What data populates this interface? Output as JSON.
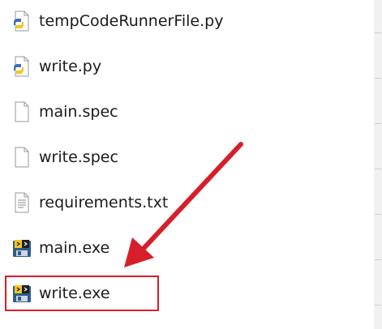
{
  "files": [
    {
      "name": "tempCodeRunnerFile.py",
      "icon": "python-file-icon"
    },
    {
      "name": "write.py",
      "icon": "python-file-icon"
    },
    {
      "name": "main.spec",
      "icon": "blank-file-icon"
    },
    {
      "name": "write.spec",
      "icon": "blank-file-icon"
    },
    {
      "name": "requirements.txt",
      "icon": "text-file-icon"
    },
    {
      "name": "main.exe",
      "icon": "pyinstaller-exe-icon"
    },
    {
      "name": "write.exe",
      "icon": "pyinstaller-exe-icon"
    }
  ],
  "annotation": {
    "highlighted_file": "write.exe",
    "color": "#d61f2b"
  }
}
